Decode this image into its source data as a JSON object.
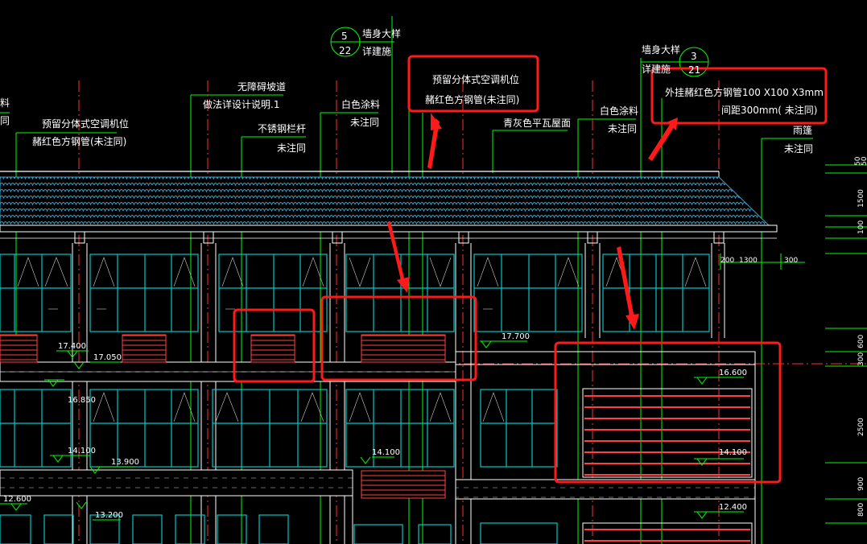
{
  "colors": {
    "background": "#000000",
    "window": "#00c8c8",
    "leader": "#00ff00",
    "axis": "#ff3030",
    "roof": "#3aa0c8",
    "louver": "#ff4040",
    "highlight": "#ff1a1a",
    "text": "#ffffff",
    "structure": "#ffffff"
  },
  "annotations": {
    "left_partial_1": "料",
    "left_partial_2": "同",
    "ac_left_1": "预留分体式空调机位",
    "ac_left_2": "赭红色方钢管(未注同)",
    "ramp_1": "无障碍坡道",
    "ramp_2": "做法详设计说明.1",
    "railing_1": "不锈钢栏杆",
    "railing_2": "未注同",
    "white_paint_1": "白色涂料",
    "white_paint_2": "未注同",
    "wall_detail_1": "墙身大样",
    "wall_detail_2": "详建施",
    "detail_num_top": "5",
    "detail_num_bottom": "22",
    "ac_box_1": "预留分体式空调机位",
    "ac_box_2": "赭红色方钢管(未注同)",
    "tile_roof": "青灰色平瓦屋面",
    "white_paint_b_1": "白色涂料",
    "white_paint_b_2": "未注同",
    "wall_detail_b_1": "墙身大样",
    "wall_detail_b_2": "详建施",
    "detail_b_num_top": "3",
    "detail_b_num_bottom": "21",
    "steel_tube_1": "外挂赭红色方钢管100  X100  X3mm",
    "steel_tube_2": "间距300mm(    未注同)",
    "canopy_1": "雨篷",
    "canopy_2": "未注同"
  },
  "levels": {
    "l17400": "17.400",
    "l17050": "17.050",
    "l17700": "17.700",
    "l16600": "16.600",
    "l16850": "16.850",
    "l14100_a": "14.100",
    "l13900": "13.900",
    "l14100_b": "14.100",
    "l14100_c": "14.100",
    "l12600": "12.600",
    "l13200": "13.200",
    "l12400": "12.400"
  },
  "dimensions": {
    "d200": "200",
    "d1300": "1300",
    "d300": "300",
    "v50a": "50",
    "v50b": "50",
    "v1500": "1500",
    "v100": "100",
    "v600": "600",
    "v300": "300",
    "v2500": "2500",
    "v900": "900",
    "v800": "800"
  }
}
